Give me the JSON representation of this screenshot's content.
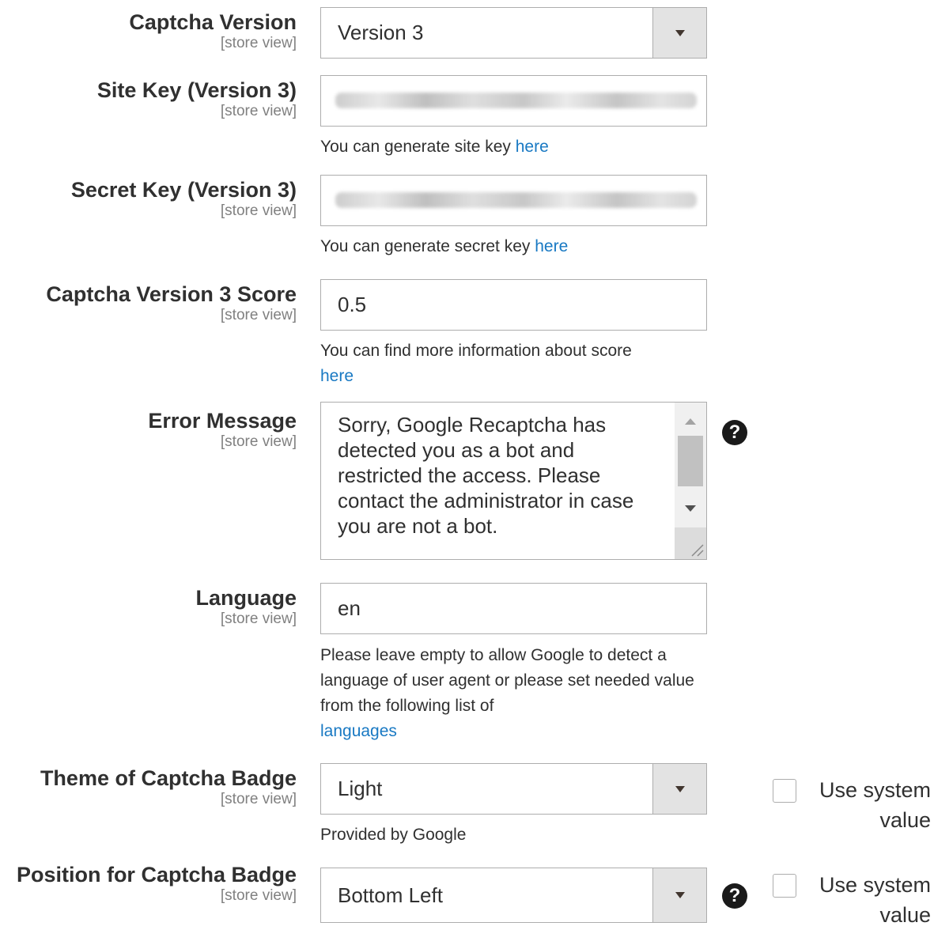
{
  "scope_label": "[store view]",
  "captcha_version": {
    "label": "Captcha Version",
    "value": "Version 3"
  },
  "site_key": {
    "label": "Site Key (Version 3)",
    "note_text": "You can generate site key ",
    "note_link": "here"
  },
  "secret_key": {
    "label": "Secret Key (Version 3)",
    "note_text": "You can generate secret key ",
    "note_link": "here"
  },
  "score": {
    "label": "Captcha Version 3 Score",
    "value": "0.5",
    "note_text": "You can find more information about score",
    "note_link": "here"
  },
  "error_message": {
    "label": "Error Message",
    "value": "Sorry, Google Recaptcha has detected you as a bot and restricted the access. Please contact the administrator in case you are not a bot."
  },
  "language": {
    "label": "Language",
    "value": "en",
    "note_text": "Please leave empty to allow Google to detect a language of user agent or please set needed value from the following list of",
    "note_link": "languages"
  },
  "theme": {
    "label": "Theme of Captcha Badge",
    "value": "Light",
    "note": "Provided by Google",
    "use_system_value": "Use system value"
  },
  "position": {
    "label": "Position for Captcha Badge",
    "value": "Bottom Left",
    "use_system_value": "Use system value"
  },
  "icons": {
    "help": "question-circle",
    "dropdown": "triangle-down"
  },
  "colors": {
    "link": "#1979c3",
    "text": "#303030",
    "scope": "#808080",
    "border": "#adadad",
    "select_arrow_bg": "#e3e3e3"
  }
}
